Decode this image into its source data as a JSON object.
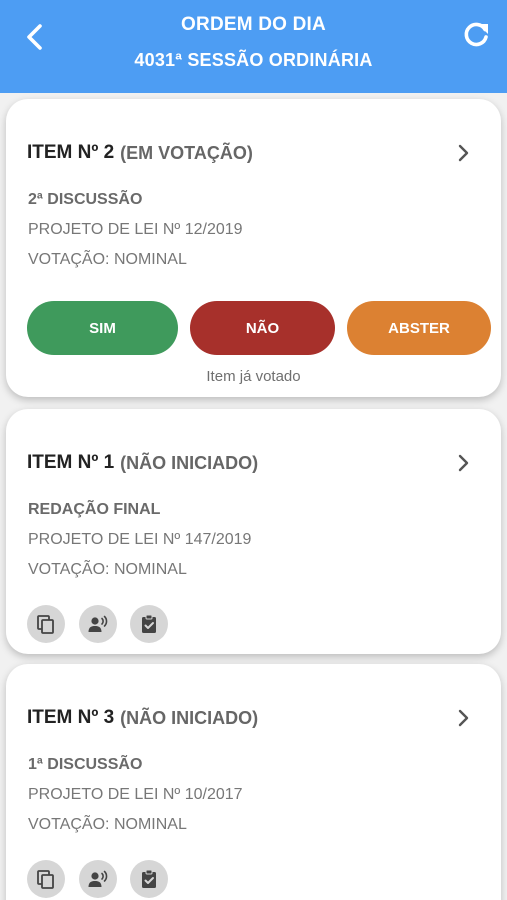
{
  "header": {
    "title": "ORDEM DO DIA",
    "subtitle": "4031ª SESSÃO ORDINÁRIA",
    "color": "#4d9df3"
  },
  "items": [
    {
      "number": "ITEM Nº 2",
      "status": "(EM VOTAÇÃO)",
      "phase": "2ª DISCUSSÃO",
      "project": "PROJETO DE LEI  Nº 12/2019",
      "voting": "VOTAÇÃO: NOMINAL",
      "buttons": [
        {
          "label": "SIM",
          "color": "#3f9a5c"
        },
        {
          "label": "NÃO",
          "color": "#a7302b"
        },
        {
          "label": "ABSTER",
          "color": "#dc8132"
        }
      ],
      "note": "Item já votado"
    },
    {
      "number": "ITEM Nº 1",
      "status": "(NÃO INICIADO)",
      "phase": "REDAÇÃO FINAL",
      "project": "PROJETO DE LEI  Nº 147/2019",
      "voting": "VOTAÇÃO: NOMINAL",
      "actions": [
        "copy-icon",
        "speaker-icon",
        "clipboard-check-icon"
      ]
    },
    {
      "number": "ITEM Nº 3",
      "status": "(NÃO INICIADO)",
      "phase": "1ª DISCUSSÃO",
      "project": "PROJETO DE LEI  Nº 10/2017",
      "voting": "VOTAÇÃO: NOMINAL",
      "actions": [
        "copy-icon",
        "speaker-icon",
        "clipboard-check-icon"
      ]
    }
  ]
}
